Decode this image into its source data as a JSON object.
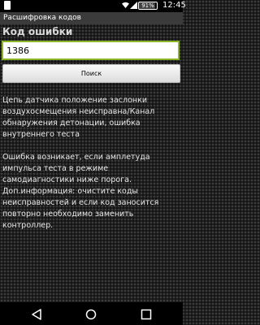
{
  "status_bar": {
    "time": "12:45",
    "battery_percent_label": "91%",
    "battery_level": 0.91,
    "icons": [
      "app-icon",
      "wifi-icon",
      "signal-icon",
      "battery-icon"
    ]
  },
  "title_bar": {
    "title": "Расшифровка кодов"
  },
  "form": {
    "code_label": "Код ошибки",
    "code_value": "1386",
    "search_label": "Поиск"
  },
  "result": {
    "text": "Цепь датчика положение заслонки воздухосмещения неисправна/Канал обнаружения детонации, ошибка внутреннего теста\n\nОшибка возникает, если амплетуда импульса теста в режиме самодиагностики ниже порога. Доп.информация: очистите коды неисправностей и если код заносится повторно необходимо заменить контроллер."
  },
  "nav_bar": {
    "icons": [
      "back-icon",
      "home-icon",
      "recent-apps-icon"
    ]
  },
  "colors": {
    "input_border": "#8db52a",
    "title_bar_bg": "#3b3b3b",
    "text": "#e8e8e8"
  }
}
